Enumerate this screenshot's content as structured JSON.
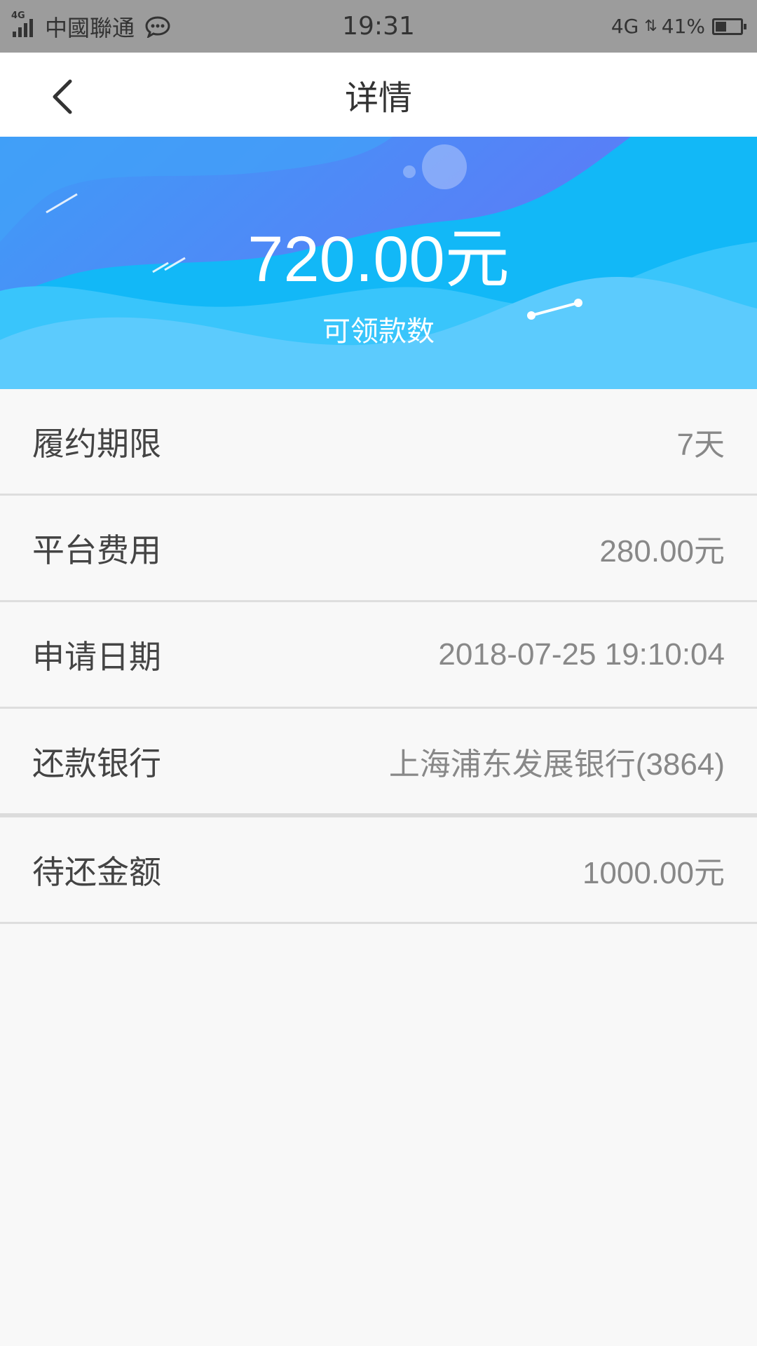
{
  "status_bar": {
    "network_tag": "4G",
    "carrier": "中國聯通",
    "time": "19:31",
    "network_right": "4G",
    "battery": "41%",
    "icons": [
      "signal-icon",
      "message-icon",
      "battery-charging-icon"
    ]
  },
  "header": {
    "title": "详情",
    "back_icon": "chevron-left-icon"
  },
  "banner": {
    "amount": "720.00元",
    "amount_label": "可领款数",
    "colors": {
      "primary": "#12b8f7",
      "secondary": "#4f86f7",
      "light": "#5ccbfd"
    }
  },
  "details": [
    {
      "label": "履约期限",
      "value": "7天"
    },
    {
      "label": "平台费用",
      "value": "280.00元"
    },
    {
      "label": "申请日期",
      "value": "2018-07-25 19:10:04"
    },
    {
      "label": "还款银行",
      "value": "上海浦东发展银行(3864)"
    },
    {
      "label": "待还金额",
      "value": "1000.00元"
    }
  ]
}
